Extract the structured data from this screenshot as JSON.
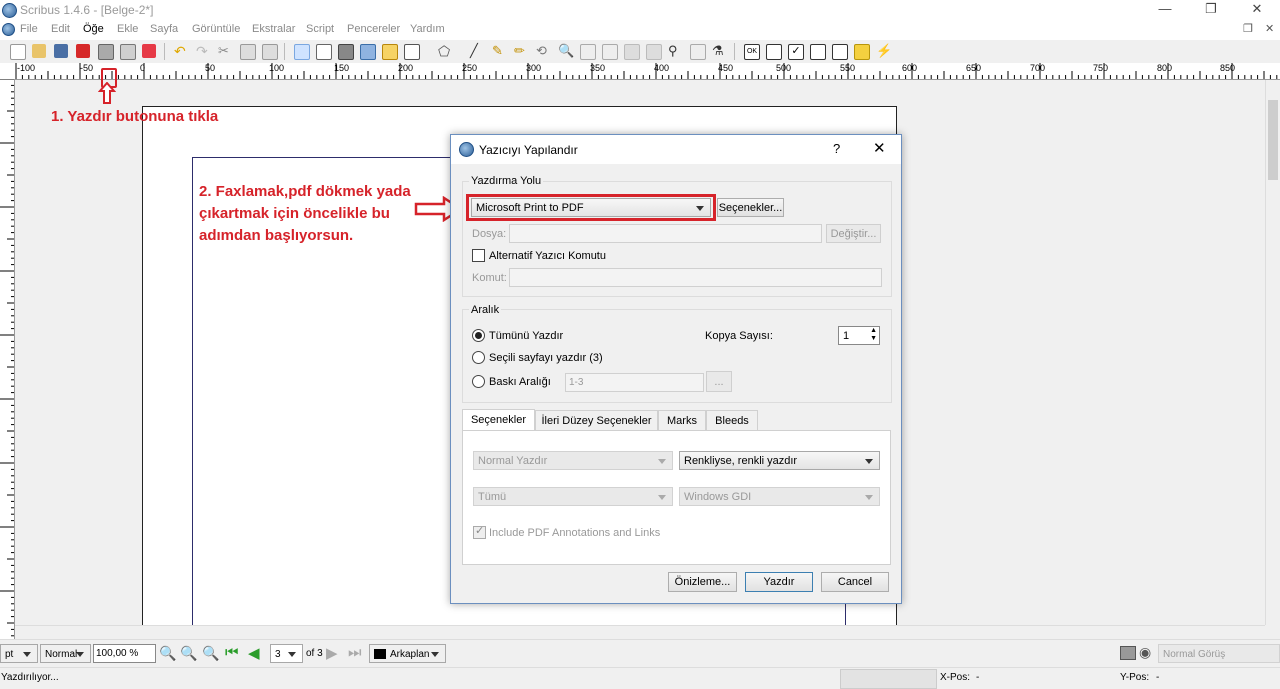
{
  "window": {
    "title": "Scribus 1.4.6 - [Belge-2*]"
  },
  "menu": [
    "File",
    "Edit",
    "Öğe",
    "Ekle",
    "Sayfa",
    "Görüntüle",
    "Ekstralar",
    "Script",
    "Pencereler",
    "Yardım"
  ],
  "ruler": {
    "labels": [
      "-100",
      "-50",
      "0",
      "50",
      "100",
      "150",
      "200",
      "250",
      "300",
      "350",
      "400",
      "450",
      "500",
      "550",
      "600",
      "650",
      "700",
      "750",
      "800",
      "850"
    ]
  },
  "annotations": {
    "step1": "1. Yazdır butonuna tıkla",
    "step2_line1": "2. Faxlamak,pdf dökmek yada",
    "step2_line2": "çıkartmak için öncelikle bu",
    "step2_line3": "adımdan başlıyorsun."
  },
  "dialog": {
    "title": "Yazıcıyı Yapılandır",
    "help": "?",
    "print_dest": {
      "group_label": "Yazdırma Yolu",
      "printer": "Microsoft Print to PDF",
      "options_button": "Seçenekler...",
      "file_label": "Dosya:",
      "file_value": "",
      "change_button": "Değiştir...",
      "alt_command_label": "Alternatif Yazıcı Komutu",
      "command_label": "Komut:"
    },
    "range": {
      "group_label": "Aralık",
      "all": "Tümünü Yazdır",
      "current": "Seçili sayfayı yazdır (3)",
      "range_label": "Baskı Aralığı",
      "range_value": "1-3",
      "range_button": "...",
      "copies_label": "Kopya Sayısı:",
      "copies_value": "1"
    },
    "tabs": [
      "Seçenekler",
      "İleri Düzey Seçenekler",
      "Marks",
      "Bleeds"
    ],
    "options": {
      "print_mode": "Normal Yazdır",
      "color_mode": "Renkliyse, renkli yazdır",
      "separation": "Tümü",
      "driver": "Windows GDI",
      "pdf_annotations": "Include PDF Annotations and Links"
    },
    "buttons": {
      "preview": "Önizleme...",
      "print": "Yazdır",
      "cancel": "Cancel"
    }
  },
  "zoombar": {
    "unit": "pt",
    "quality": "Normal",
    "zoom": "100,00 %",
    "page": "3",
    "of_pages": "of 3",
    "layer": "Arkaplan",
    "view_mode": "Normal Görüş"
  },
  "status": {
    "message": "Yazdırılıyor...",
    "xpos_label": "X-Pos:",
    "xpos_value": "-",
    "ypos_label": "Y-Pos:",
    "ypos_value": "-"
  },
  "colors": {
    "accent_red": "#d6232a",
    "dialog_border": "#6b8fbf"
  }
}
